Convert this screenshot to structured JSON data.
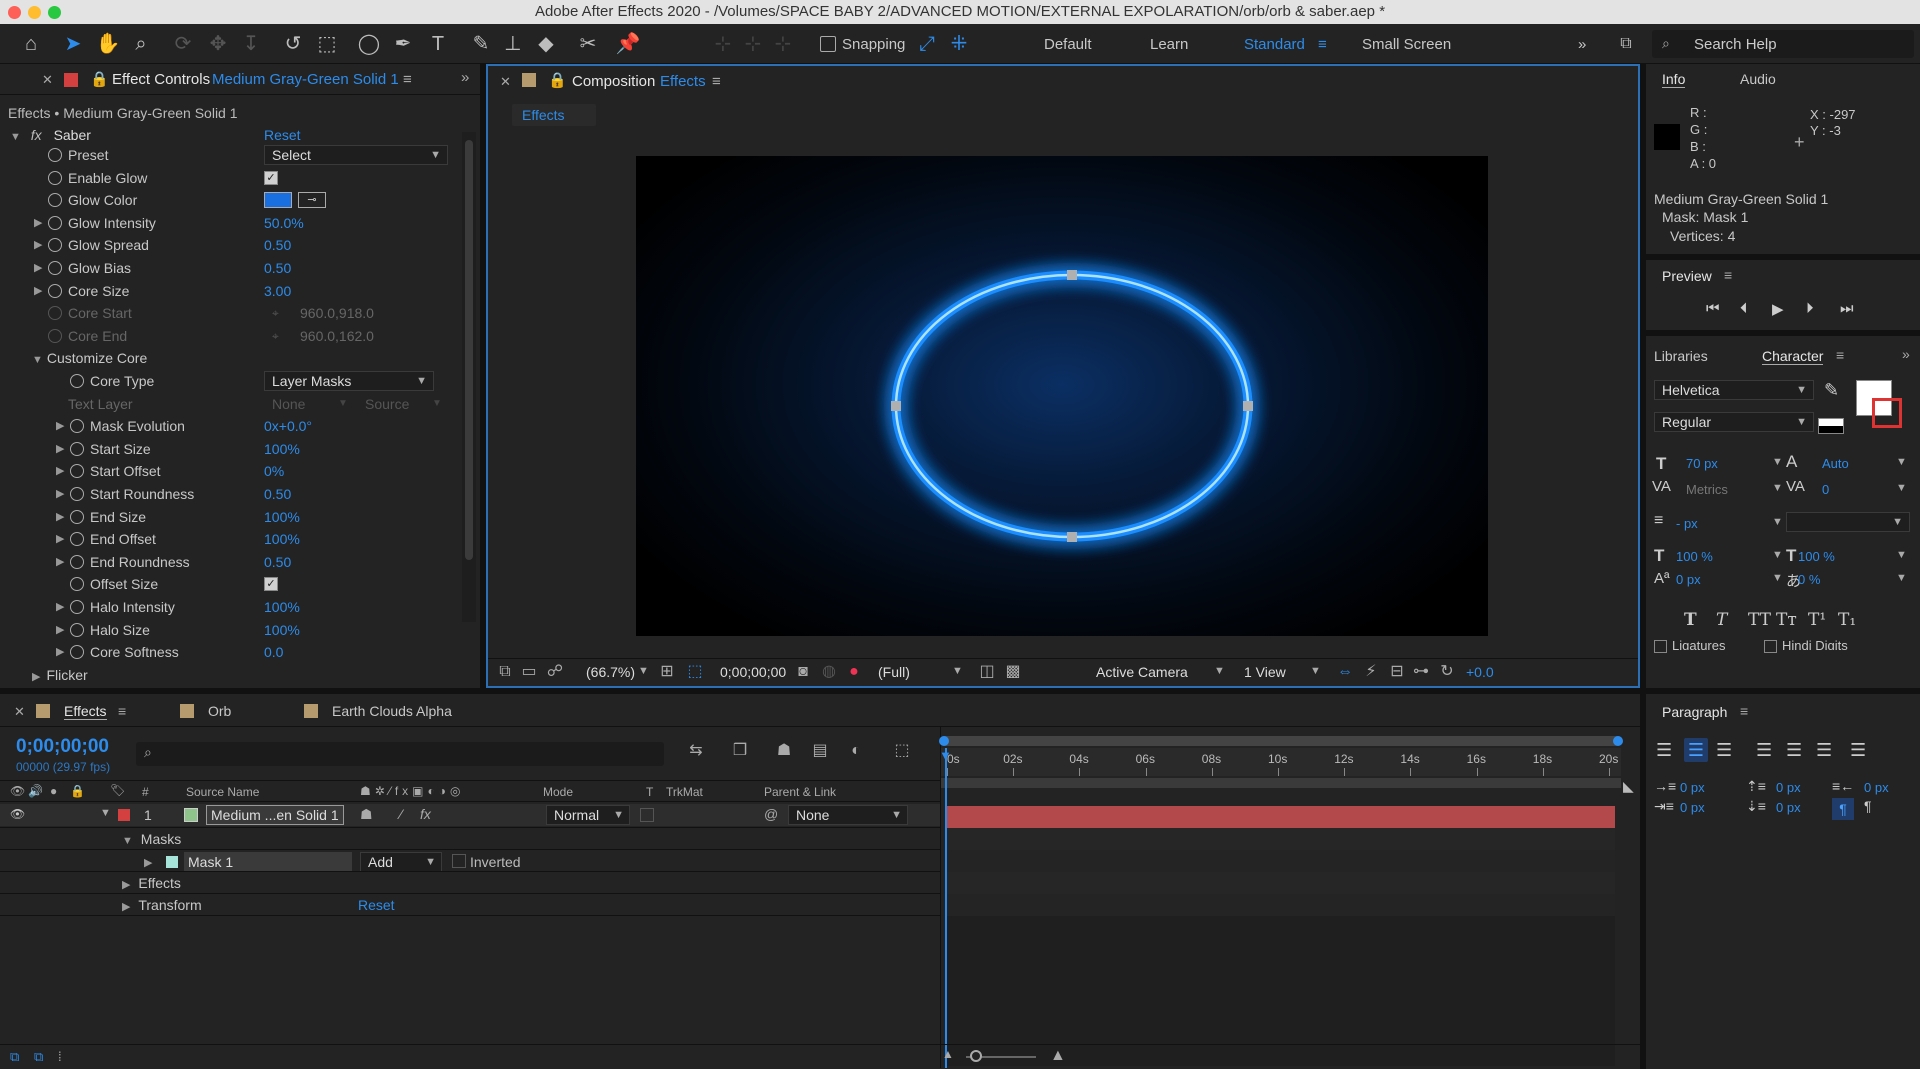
{
  "window": {
    "title": "Adobe After Effects 2020 - /Volumes/SPACE BABY 2/ADVANCED MOTION/EXTERNAL EXPOLARATION/orb/orb & saber.aep *"
  },
  "toolbar": {
    "snapping_label": "Snapping",
    "workspaces": [
      "Default",
      "Learn",
      "Standard",
      "Small Screen"
    ],
    "search_placeholder": "Search Help"
  },
  "effect_controls": {
    "tab_label": "Effect Controls",
    "layer_name": "Medium Gray-Green Solid 1",
    "breadcrumb": "Effects • Medium Gray-Green Solid 1",
    "effect_name": "Saber",
    "reset_label": "Reset",
    "params": [
      {
        "label": "Preset",
        "value": "Select"
      },
      {
        "label": "Enable Glow",
        "value": ""
      },
      {
        "label": "Glow Color",
        "value": ""
      },
      {
        "label": "Glow Intensity",
        "value": "50.0%"
      },
      {
        "label": "Glow Spread",
        "value": "0.50"
      },
      {
        "label": "Glow Bias",
        "value": "0.50"
      },
      {
        "label": "Core Size",
        "value": "3.00"
      },
      {
        "label": "Core Start",
        "value": "960.0,918.0"
      },
      {
        "label": "Core End",
        "value": "960.0,162.0"
      }
    ],
    "customize_core_label": "Customize Core",
    "core_params": [
      {
        "label": "Core Type",
        "value": "Layer Masks"
      },
      {
        "label": "Text Layer",
        "value": "None"
      },
      {
        "label": "Mask Evolution",
        "value": "0x+0.0°"
      },
      {
        "label": "Start Size",
        "value": "100%"
      },
      {
        "label": "Start Offset",
        "value": "0%"
      },
      {
        "label": "Start Roundness",
        "value": "0.50"
      },
      {
        "label": "End Size",
        "value": "100%"
      },
      {
        "label": "End Offset",
        "value": "100%"
      },
      {
        "label": "End Roundness",
        "value": "0.50"
      },
      {
        "label": "Offset Size",
        "value": ""
      },
      {
        "label": "Halo Intensity",
        "value": "100%"
      },
      {
        "label": "Halo Size",
        "value": "100%"
      },
      {
        "label": "Core Softness",
        "value": "0.0"
      }
    ],
    "text_layer_source": "Source",
    "flicker_label": "Flicker",
    "glow_color": "#1a6fe0"
  },
  "composition": {
    "tab_label": "Composition",
    "comp_name": "Effects",
    "flowchart_tab": "Effects",
    "zoom": "(66.7%)",
    "timecode": "0;00;00;00",
    "resolution": "(Full)",
    "camera": "Active Camera",
    "views": "1 View",
    "exposure": "+0.0"
  },
  "info": {
    "tabs": [
      "Info",
      "Audio"
    ],
    "r": "R :",
    "g": "G :",
    "b": "B :",
    "a": "A :  0",
    "x": "X : -297",
    "y": "Y : -3",
    "layer": "Medium Gray-Green Solid 1",
    "mask": "Mask: Mask 1",
    "vertices": "Vertices: 4"
  },
  "preview": {
    "title": "Preview"
  },
  "character": {
    "tabs": [
      "Libraries",
      "Character"
    ],
    "font": "Helvetica",
    "style": "Regular",
    "size": "70 px",
    "leading": "Auto",
    "kerning": "Metrics",
    "tracking": "0",
    "stroke": "- px",
    "vscale": "100 %",
    "hscale": "100 %",
    "baseline": "0 px",
    "tsume": "0 %",
    "ligatures": "Ligatures",
    "hindi": "Hindi Digits"
  },
  "paragraph": {
    "title": "Paragraph",
    "indents": [
      "0 px",
      "0 px",
      "0 px",
      "0 px",
      "0 px"
    ]
  },
  "timeline": {
    "tabs": [
      "Effects",
      "Orb",
      "Earth Clouds Alpha"
    ],
    "timecode": "0;00;00;00",
    "frames": "00000 (29.97 fps)",
    "columns": {
      "num": "#",
      "source": "Source Name",
      "mode": "Mode",
      "t": "T",
      "trkmat": "TrkMat",
      "parent": "Parent & Link"
    },
    "layer": {
      "num": "1",
      "name": "Medium ...en Solid 1",
      "mode": "Normal",
      "parent": "None"
    },
    "masks_label": "Masks",
    "mask_name": "Mask 1",
    "mask_mode": "Add",
    "inverted_label": "Inverted",
    "effects_label": "Effects",
    "transform_label": "Transform",
    "reset_label": "Reset",
    "ruler": [
      "0s",
      "02s",
      "04s",
      "06s",
      "08s",
      "10s",
      "12s",
      "14s",
      "16s",
      "18s",
      "20s"
    ]
  }
}
